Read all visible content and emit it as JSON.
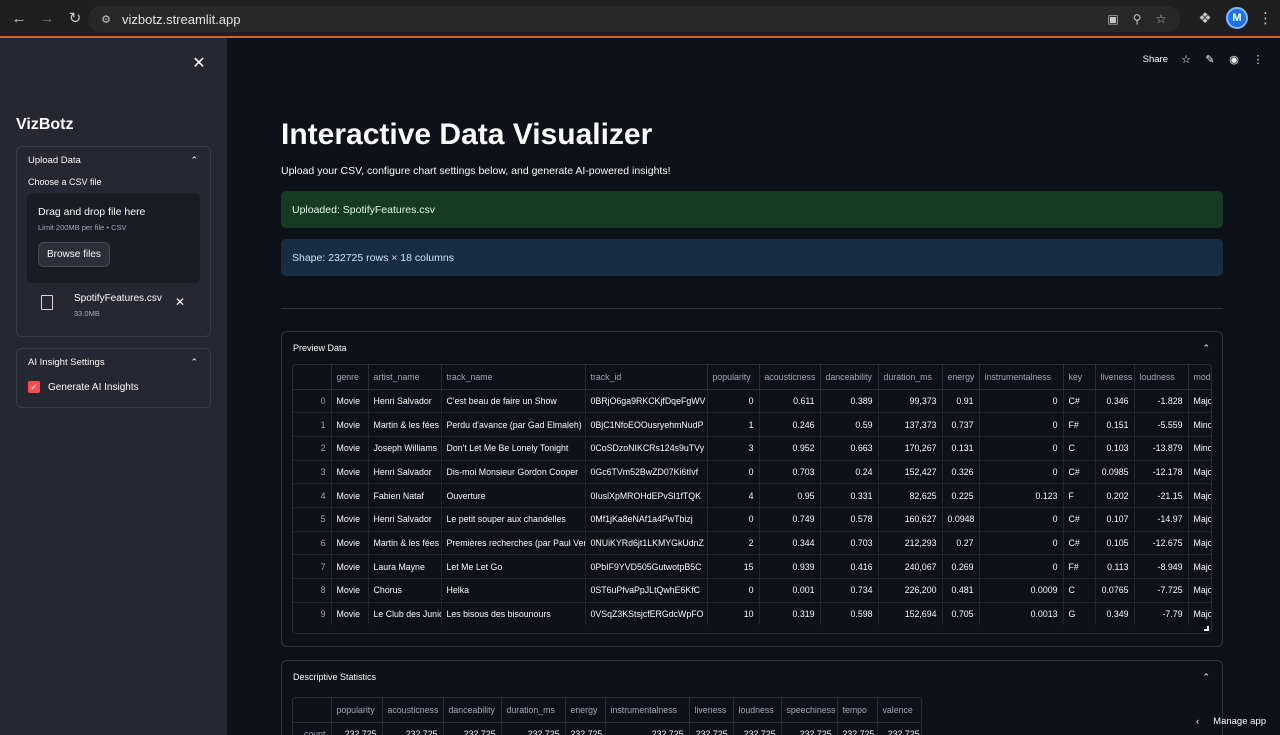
{
  "browser": {
    "url": "vizbotz.streamlit.app",
    "avatar_letter": "M"
  },
  "sidebar": {
    "title": "VizBotz",
    "upload": {
      "header": "Upload Data",
      "label": "Choose a CSV file",
      "drop_title": "Drag and drop file here",
      "drop_sub": "Limit 200MB per file • CSV",
      "browse_label": "Browse files",
      "file_name": "SpotifyFeatures.csv",
      "file_size": "33.0MB"
    },
    "ai": {
      "header": "AI Insight Settings",
      "checkbox_label": "Generate AI Insights",
      "checked": true
    }
  },
  "topbar": {
    "share_label": "Share"
  },
  "main": {
    "title": "Interactive Data Visualizer",
    "subtitle": "Upload your CSV, configure chart settings below, and generate AI-powered insights!",
    "success_msg": "Uploaded: SpotifyFeatures.csv",
    "info_msg": "Shape: 232725 rows × 18 columns"
  },
  "preview": {
    "header": "Preview Data",
    "columns": [
      "",
      "genre",
      "artist_name",
      "track_name",
      "track_id",
      "popularity",
      "acousticness",
      "danceability",
      "duration_ms",
      "energy",
      "instrumentalness",
      "key",
      "liveness",
      "loudness",
      "mode"
    ],
    "rows": [
      [
        "0",
        "Movie",
        "Henri Salvador",
        "C'est beau de faire un Show",
        "0BRjO6ga9RKCKjfDqeFgWV",
        "0",
        "0.611",
        "0.389",
        "99,373",
        "0.91",
        "0",
        "C#",
        "0.346",
        "-1.828",
        "Major"
      ],
      [
        "1",
        "Movie",
        "Martin & les fées",
        "Perdu d'avance (par Gad Elmaleh)",
        "0BjC1NfoEOOusryehmNudP",
        "1",
        "0.246",
        "0.59",
        "137,373",
        "0.737",
        "0",
        "F#",
        "0.151",
        "-5.559",
        "Minor"
      ],
      [
        "2",
        "Movie",
        "Joseph Williams",
        "Don't Let Me Be Lonely Tonight",
        "0CoSDzoNIKCRs124s9uTVy",
        "3",
        "0.952",
        "0.663",
        "170,267",
        "0.131",
        "0",
        "C",
        "0.103",
        "-13.879",
        "Minor"
      ],
      [
        "3",
        "Movie",
        "Henri Salvador",
        "Dis-moi Monsieur Gordon Cooper",
        "0Gc6TVm52BwZD07Ki6tIvf",
        "0",
        "0.703",
        "0.24",
        "152,427",
        "0.326",
        "0",
        "C#",
        "0.0985",
        "-12.178",
        "Major"
      ],
      [
        "4",
        "Movie",
        "Fabien Nataf",
        "Ouverture",
        "0IuslXpMROHdEPvSl1fTQK",
        "4",
        "0.95",
        "0.331",
        "82,625",
        "0.225",
        "0.123",
        "F",
        "0.202",
        "-21.15",
        "Major"
      ],
      [
        "5",
        "Movie",
        "Henri Salvador",
        "Le petit souper aux chandelles",
        "0Mf1jKa8eNAf1a4PwTbizj",
        "0",
        "0.749",
        "0.578",
        "160,627",
        "0.0948",
        "0",
        "C#",
        "0.107",
        "-14.97",
        "Major"
      ],
      [
        "6",
        "Movie",
        "Martin & les fées",
        "Premières recherches (par Paul Ven",
        "0NUiKYRd6jt1LKMYGkUdnZ",
        "2",
        "0.344",
        "0.703",
        "212,293",
        "0.27",
        "0",
        "C#",
        "0.105",
        "-12.675",
        "Major"
      ],
      [
        "7",
        "Movie",
        "Laura Mayne",
        "Let Me Let Go",
        "0PbIF9YVD505GutwotpB5C",
        "15",
        "0.939",
        "0.416",
        "240,067",
        "0.269",
        "0",
        "F#",
        "0.113",
        "-8.949",
        "Major"
      ],
      [
        "8",
        "Movie",
        "Chorus",
        "Helka",
        "0ST6uPfvaPpJLtQwhE6KfC",
        "0",
        "0.001",
        "0.734",
        "226,200",
        "0.481",
        "0.0009",
        "C",
        "0.0765",
        "-7.725",
        "Major"
      ],
      [
        "9",
        "Movie",
        "Le Club des Junio",
        "Les bisous des bisounours",
        "0VSqZ3KStsjcfERGdcWpFO",
        "10",
        "0.319",
        "0.598",
        "152,694",
        "0.705",
        "0.0013",
        "G",
        "0.349",
        "-7.79",
        "Major"
      ]
    ]
  },
  "stats": {
    "header": "Descriptive Statistics",
    "columns": [
      "",
      "popularity",
      "acousticness",
      "danceability",
      "duration_ms",
      "energy",
      "instrumentalness",
      "liveness",
      "loudness",
      "speechiness",
      "tempo",
      "valence"
    ],
    "rows": [
      [
        "count",
        "232,725",
        "232,725",
        "232,725",
        "232,725",
        "232,725",
        "232,725",
        "232,725",
        "232,725",
        "232,725",
        "232,725",
        "232,725"
      ]
    ]
  },
  "footer": {
    "manage_label": "Manage app"
  }
}
